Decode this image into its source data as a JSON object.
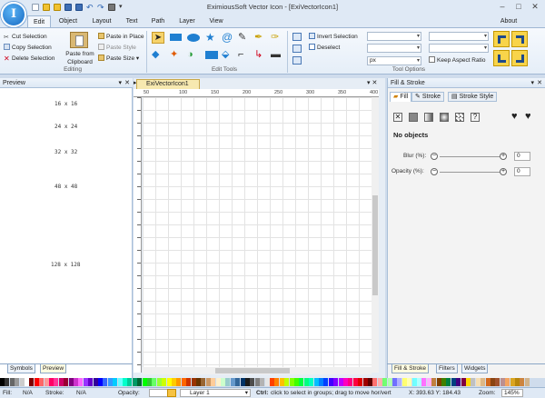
{
  "window": {
    "title": "EximiousSoft Vector Icon - [ExiVectorIcon1]",
    "app_icon_letter": "I"
  },
  "tabs": [
    {
      "label": "Edit",
      "active": true
    },
    {
      "label": "Object",
      "active": false
    },
    {
      "label": "Layout",
      "active": false
    },
    {
      "label": "Text",
      "active": false
    },
    {
      "label": "Path",
      "active": false
    },
    {
      "label": "Layer",
      "active": false
    },
    {
      "label": "View",
      "active": false
    }
  ],
  "about": "About",
  "ribbon": {
    "cut": "Cut Selection",
    "copy": "Copy Selection",
    "delete": "Delete Selection",
    "paste_from": "Paste from",
    "clipboard": "Clipboard",
    "paste_in_place": "Paste in Place",
    "paste_style": "Paste Style",
    "paste_size": "Paste Size",
    "editing_label": "Editing",
    "edit_tools_label": "Edit Tools",
    "invert_selection": "Invert Selection",
    "deselect": "Deselect",
    "units": "px",
    "keep_aspect": "Keep Aspect Ratio",
    "tool_options_label": "Tool Options"
  },
  "preview": {
    "title": "Preview",
    "sizes": [
      "16 x 16",
      "24 x 24",
      "32 x 32",
      "48 x 48",
      "128 x 128"
    ],
    "tabs": [
      {
        "label": "Symbols",
        "active": false
      },
      {
        "label": "Preview",
        "active": true
      }
    ]
  },
  "document": {
    "tab": "ExiVectorIcon1",
    "ruler_top": [
      "0",
      "50",
      "100",
      "150",
      "200",
      "250",
      "300",
      "350",
      "400"
    ]
  },
  "fill_stroke": {
    "title": "Fill & Stroke",
    "tabs": [
      {
        "label": "Fill",
        "active": true
      },
      {
        "label": "Stroke",
        "active": false
      },
      {
        "label": "Stroke Style",
        "active": false
      }
    ],
    "no_objects": "No objects",
    "blur_label": "Blur (%):",
    "blur_value": "0",
    "opacity_label": "Opacity (%):",
    "opacity_value": "0",
    "bottom_tabs": [
      {
        "label": "Fill & Stroke",
        "active": true
      },
      {
        "label": "Filters",
        "active": false
      },
      {
        "label": "Widgets",
        "active": false
      }
    ]
  },
  "status": {
    "fill_label": "Fill:",
    "fill_value": "N/A",
    "stroke_label": "Stroke:",
    "stroke_value": "N/A",
    "opacity_label": "Opacity:",
    "layer": "Layer 1",
    "hint_bold": "Ctrl:",
    "hint": "click to select in groups; drag to move hor/vert",
    "coords": "X: 393.63 Y: 184.43",
    "zoom_label": "Zoom:",
    "zoom_value": "145%"
  },
  "palette_colors": [
    "#000000",
    "#333333",
    "#666666",
    "#999999",
    "#cccccc",
    "#ffffff",
    "#7f0000",
    "#ff0000",
    "#ff6666",
    "#ff9999",
    "#ff0066",
    "#ff3399",
    "#cc0066",
    "#990033",
    "#800080",
    "#cc33cc",
    "#ff66ff",
    "#9933ff",
    "#6600cc",
    "#330099",
    "#0000ff",
    "#3366ff",
    "#3399ff",
    "#00ccff",
    "#66ffff",
    "#00ffcc",
    "#00cc99",
    "#009966",
    "#006633",
    "#00ff00",
    "#33cc33",
    "#66ff66",
    "#99ff33",
    "#ccff00",
    "#ffff00",
    "#ffcc00",
    "#ff9900",
    "#ff6600",
    "#cc3300",
    "#993300",
    "#663300",
    "#996633",
    "#cc9966",
    "#ffcc99",
    "#fff0cc",
    "#ccffcc",
    "#99cccc",
    "#6699cc",
    "#336699",
    "#003366",
    "#1a1a1a",
    "#4d4d4d",
    "#808080",
    "#b3b3b3",
    "#e6e6e6",
    "#ff4000",
    "#ff8000",
    "#ffbf00",
    "#bfff00",
    "#80ff00",
    "#40ff00",
    "#00ff40",
    "#00ff80",
    "#00ffbf",
    "#00bfff",
    "#0080ff",
    "#0040ff",
    "#4000ff",
    "#8000ff",
    "#bf00ff",
    "#ff00bf",
    "#ff0080",
    "#ff0040",
    "#e00000",
    "#a00000",
    "#600000",
    "#ff7070",
    "#ffb0b0",
    "#70ff70",
    "#b0ffb0",
    "#7070ff",
    "#b0b0ff",
    "#ffff70",
    "#ffffb0",
    "#70ffff",
    "#b0ffff",
    "#ff70ff",
    "#ffb0ff",
    "#c08040",
    "#804000",
    "#408000",
    "#008040",
    "#004080",
    "#400080",
    "#800040",
    "#ffd700",
    "#c0c0c0",
    "#f5deb3",
    "#deb887",
    "#d2691e",
    "#8b4513",
    "#a0522d",
    "#bc8f8f",
    "#f4a460",
    "#daa520",
    "#b8860b",
    "#cd853f",
    "#d2b48c"
  ]
}
